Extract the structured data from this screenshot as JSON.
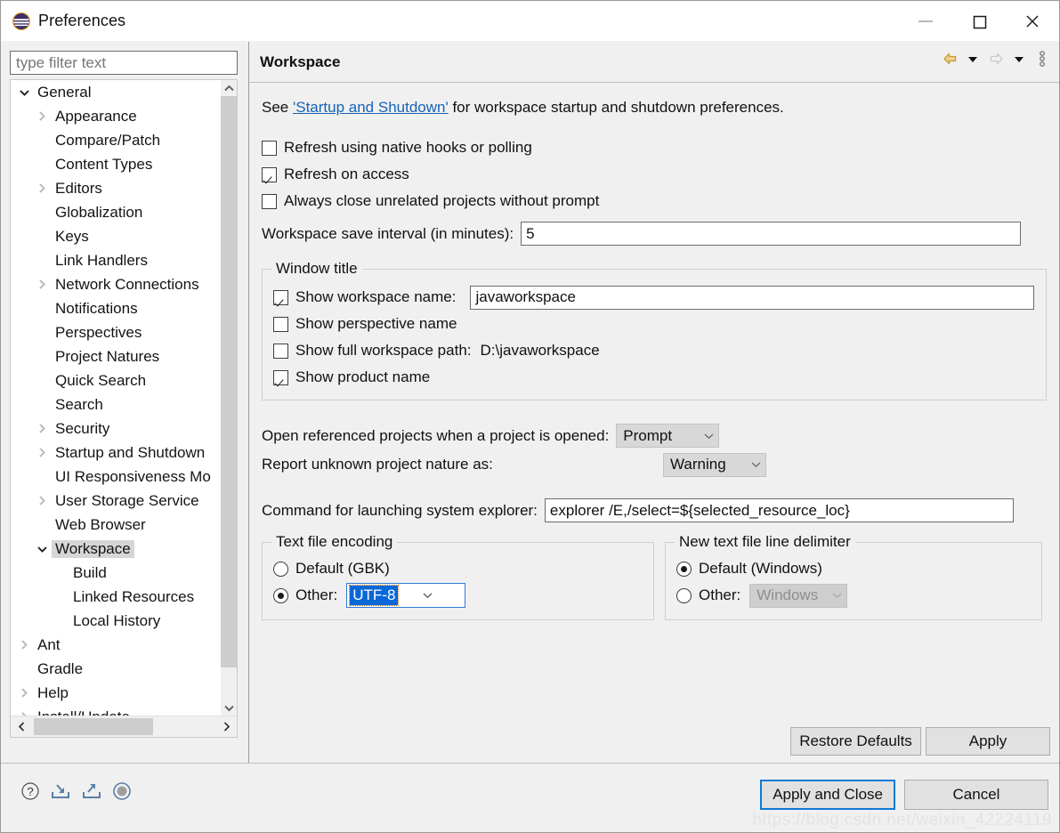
{
  "window": {
    "title": "Preferences",
    "icon": "eclipse-logo-icon",
    "minimize_label": "—",
    "maximize_label": "□",
    "close_label": "✕"
  },
  "sidebar": {
    "filter_placeholder": "type filter text",
    "filter_value": "",
    "items": [
      {
        "label": "General",
        "indent": 0,
        "twisty": "down",
        "selected": false
      },
      {
        "label": "Appearance",
        "indent": 1,
        "twisty": "right",
        "selected": false
      },
      {
        "label": "Compare/Patch",
        "indent": 1,
        "twisty": "none",
        "selected": false
      },
      {
        "label": "Content Types",
        "indent": 1,
        "twisty": "none",
        "selected": false
      },
      {
        "label": "Editors",
        "indent": 1,
        "twisty": "right",
        "selected": false
      },
      {
        "label": "Globalization",
        "indent": 1,
        "twisty": "none",
        "selected": false
      },
      {
        "label": "Keys",
        "indent": 1,
        "twisty": "none",
        "selected": false
      },
      {
        "label": "Link Handlers",
        "indent": 1,
        "twisty": "none",
        "selected": false
      },
      {
        "label": "Network Connections",
        "indent": 1,
        "twisty": "right",
        "selected": false
      },
      {
        "label": "Notifications",
        "indent": 1,
        "twisty": "none",
        "selected": false
      },
      {
        "label": "Perspectives",
        "indent": 1,
        "twisty": "none",
        "selected": false
      },
      {
        "label": "Project Natures",
        "indent": 1,
        "twisty": "none",
        "selected": false
      },
      {
        "label": "Quick Search",
        "indent": 1,
        "twisty": "none",
        "selected": false
      },
      {
        "label": "Search",
        "indent": 1,
        "twisty": "none",
        "selected": false
      },
      {
        "label": "Security",
        "indent": 1,
        "twisty": "right",
        "selected": false
      },
      {
        "label": "Startup and Shutdown",
        "indent": 1,
        "twisty": "right",
        "selected": false
      },
      {
        "label": "UI Responsiveness Mo",
        "indent": 1,
        "twisty": "none",
        "selected": false
      },
      {
        "label": "User Storage Service",
        "indent": 1,
        "twisty": "right",
        "selected": false
      },
      {
        "label": "Web Browser",
        "indent": 1,
        "twisty": "none",
        "selected": false
      },
      {
        "label": "Workspace",
        "indent": 1,
        "twisty": "down",
        "selected": true
      },
      {
        "label": "Build",
        "indent": 2,
        "twisty": "none",
        "selected": false
      },
      {
        "label": "Linked Resources",
        "indent": 2,
        "twisty": "none",
        "selected": false
      },
      {
        "label": "Local History",
        "indent": 2,
        "twisty": "none",
        "selected": false
      },
      {
        "label": "Ant",
        "indent": 0,
        "twisty": "right",
        "selected": false
      },
      {
        "label": "Gradle",
        "indent": 0,
        "twisty": "none",
        "selected": false
      },
      {
        "label": "Help",
        "indent": 0,
        "twisty": "right",
        "selected": false
      },
      {
        "label": "Install/Update",
        "indent": 0,
        "twisty": "right",
        "selected": false
      }
    ]
  },
  "page": {
    "title": "Workspace",
    "toolbar": {
      "back": "back-arrow-icon",
      "back_menu": "back-dropdown-icon",
      "forward": "forward-arrow-icon",
      "forward_menu": "forward-dropdown-icon",
      "view_menu": "view-menu-icon"
    },
    "description": {
      "prefix": "See ",
      "link": "'Startup and Shutdown'",
      "suffix": " for workspace startup and shutdown preferences."
    },
    "checkboxes": [
      {
        "label": "Refresh using native hooks or polling",
        "checked": false
      },
      {
        "label": "Refresh on access",
        "checked": true
      },
      {
        "label": "Always close unrelated projects without prompt",
        "checked": false
      }
    ],
    "save_interval": {
      "label": "Workspace save interval (in minutes):",
      "value": "5"
    },
    "window_title_group": {
      "title": "Window title",
      "show_workspace_name": {
        "label": "Show workspace name:",
        "checked": true,
        "value": "javaworkspace"
      },
      "show_perspective_name": {
        "label": "Show perspective name",
        "checked": false
      },
      "show_full_workspace_path": {
        "label": "Show full workspace path:",
        "checked": false,
        "value": "D:\\javaworkspace"
      },
      "show_product_name": {
        "label": "Show product name",
        "checked": true
      }
    },
    "open_referenced": {
      "label": "Open referenced projects when a project is opened:",
      "value": "Prompt"
    },
    "report_nature": {
      "label": "Report unknown project nature as:",
      "value": "Warning"
    },
    "explorer_command": {
      "label": "Command for launching system explorer:",
      "value": "explorer /E,/select=${selected_resource_loc}"
    },
    "text_file_encoding": {
      "title": "Text file encoding",
      "default_label": "Default (GBK)",
      "default_selected": false,
      "other_label": "Other:",
      "other_selected": true,
      "other_value": "UTF-8"
    },
    "line_delimiter": {
      "title": "New text file line delimiter",
      "default_label": "Default (Windows)",
      "default_selected": true,
      "other_label": "Other:",
      "other_selected": false,
      "other_value": "Windows",
      "other_disabled": true
    },
    "restore_defaults_label": "Restore Defaults",
    "apply_label": "Apply"
  },
  "footer": {
    "icons": [
      "help-icon",
      "import-icon",
      "export-icon",
      "oomph-icon"
    ],
    "apply_and_close_label": "Apply and Close",
    "cancel_label": "Cancel",
    "watermark": "https://blog.csdn.net/weixin_42224119"
  },
  "colors": {
    "accent_blue": "#0f7ad4",
    "link_blue": "#1763b8",
    "selection_blue": "#0a67d8",
    "back_arrow_gold": "#e8b33a",
    "panel_bg": "#f0f0f0"
  }
}
